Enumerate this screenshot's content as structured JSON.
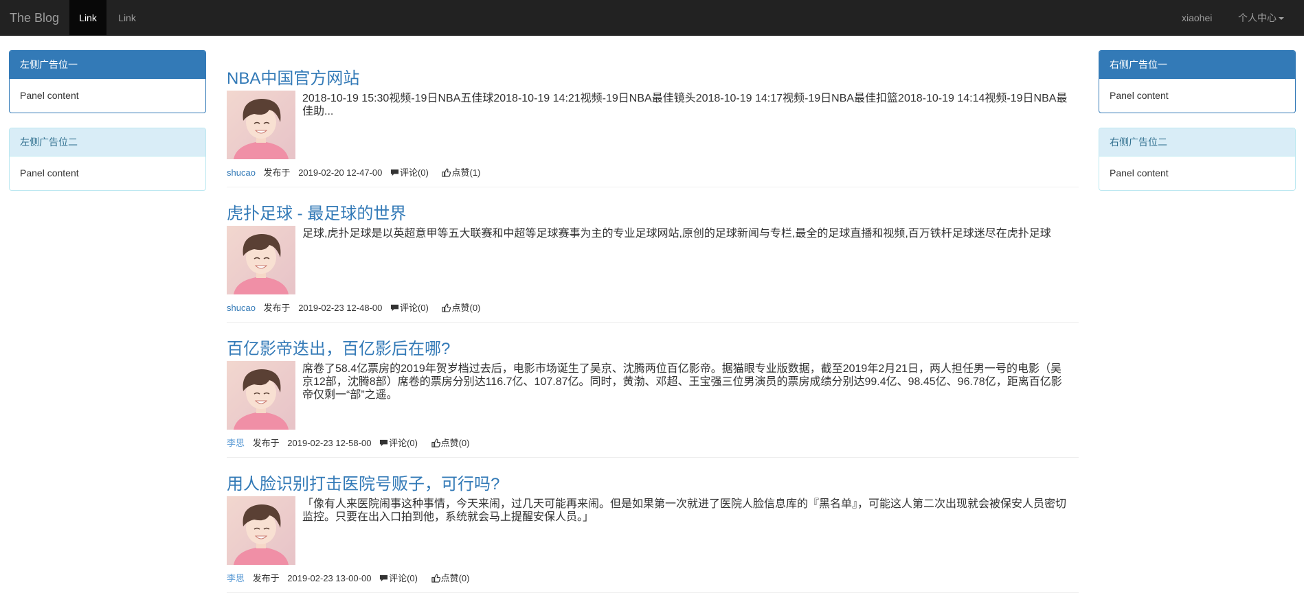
{
  "navbar": {
    "brand": "The Blog",
    "links": [
      "Link",
      "Link"
    ],
    "user": "xiaohei",
    "user_center": "个人中心"
  },
  "left_panels": [
    {
      "title": "左侧广告位一",
      "content": "Panel content"
    },
    {
      "title": "左侧广告位二",
      "content": "Panel content"
    }
  ],
  "right_panels": [
    {
      "title": "右侧广告位一",
      "content": "Panel content"
    },
    {
      "title": "右侧广告位二",
      "content": "Panel content"
    }
  ],
  "articles": [
    {
      "title": "NBA中国官方网站",
      "summary": "2018-10-19 15:30视频-19日NBA五佳球2018-10-19 14:21视频-19日NBA最佳镜头2018-10-19 14:17视频-19日NBA最佳扣篮2018-10-19 14:14视频-19日NBA最佳助...",
      "author": "shucao",
      "published_label": "发布于",
      "date": "2019-02-20 12-47-00",
      "comments": "评论(0)",
      "likes": "点赞(1)"
    },
    {
      "title": "虎扑足球 - 最足球的世界",
      "summary": "足球,虎扑足球是以英超意甲等五大联赛和中超等足球赛事为主的专业足球网站,原创的足球新闻与专栏,最全的足球直播和视频,百万铁杆足球迷尽在虎扑足球",
      "author": "shucao",
      "published_label": "发布于",
      "date": "2019-02-23 12-48-00",
      "comments": "评论(0)",
      "likes": "点赞(0)"
    },
    {
      "title": "百亿影帝迭出，百亿影后在哪?",
      "summary": "席卷了58.4亿票房的2019年贺岁档过去后，电影市场诞生了吴京、沈腾两位百亿影帝。据猫眼专业版数据，截至2019年2月21日，两人担任男一号的电影（吴京12部，沈腾8部）席卷的票房分别达116.7亿、107.87亿。同时，黄渤、邓超、王宝强三位男演员的票房成绩分别达99.4亿、98.45亿、96.78亿，距离百亿影帝仅剩一“部”之遥。",
      "author": "李思",
      "published_label": "发布于",
      "date": "2019-02-23 12-58-00",
      "comments": "评论(0)",
      "likes": "点赞(0)"
    },
    {
      "title": "用人脸识别打击医院号贩子，可行吗?",
      "summary": "「像有人来医院闹事这种事情，今天来闹，过几天可能再来闹。但是如果第一次就进了医院人脸信息库的『黑名单』，可能这人第二次出现就会被保安人员密切监控。只要在出入口拍到他，系统就会马上提醒安保人员。」",
      "author": "李思",
      "published_label": "发布于",
      "date": "2019-02-23 13-00-00",
      "comments": "评论(0)",
      "likes": "点赞(0)"
    }
  ]
}
